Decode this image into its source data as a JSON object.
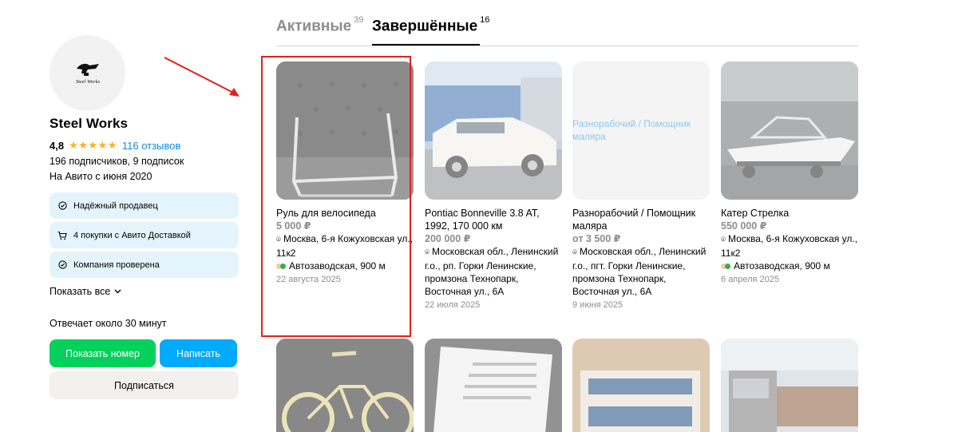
{
  "seller": {
    "name": "Steel Works",
    "logo_text": "Steel Works",
    "rating": "4,8",
    "stars": "★★★★★",
    "reviews_link": "116 отзывов",
    "subscribers": "196 подписчиков, 9 подписок",
    "since": "На Авито с июня 2020",
    "badges": [
      {
        "icon": "check-circle-icon",
        "label": "Надёжный продавец"
      },
      {
        "icon": "cart-icon",
        "label": "4 покупки с Авито Доставкой"
      },
      {
        "icon": "check-circle-icon",
        "label": "Компания проверена"
      }
    ],
    "show_all": "Показать все",
    "responds": "Отвечает около 30 минут",
    "show_phone": "Показать номер",
    "write": "Написать",
    "subscribe": "Подписаться"
  },
  "tabs": [
    {
      "label": "Активные",
      "count": "39"
    },
    {
      "label": "Завершённые",
      "count": "16"
    }
  ],
  "listings": [
    {
      "title": "Руль для велосипеда",
      "price": "5 000 ₽",
      "address": "Москва, 6-я Кожуховская ул., 11к2",
      "metro": "Автозаводская, 900 м",
      "date": "22 августа 2025"
    },
    {
      "title": "Pontiac Bonneville 3.8 AT, 1992, 170 000 км",
      "price": "200 000 ₽",
      "address": "Московская обл., Ленинский г.о., рп. Горки Ленинские, промзона Технопарк, Восточная ул., 6А",
      "date": "22 июля 2025"
    },
    {
      "title": "Разнорабочий / Помощник маляра",
      "price": "от 3 500 ₽",
      "image_alt": "Разнорабочий / Помощник маляра",
      "address": "Московская обл., Ленинский г.о., пгт. Горки Ленинские, промзона Технопарк, Восточная ул., 6А",
      "date": "9 июня 2025"
    },
    {
      "title": "Катер Стрелка",
      "price": "550 000 ₽",
      "address": "Москва, 6-я Кожуховская ул., 11к2",
      "metro": "Автозаводская, 900 м",
      "date": "6 апреля 2025"
    }
  ],
  "colors": {
    "accent_green": "#02d15c",
    "accent_blue": "#00aaff",
    "badge_bg": "#e4f4fd",
    "link": "#0a8ee8",
    "star": "#ffb021",
    "annotation_red": "#e5201b"
  }
}
